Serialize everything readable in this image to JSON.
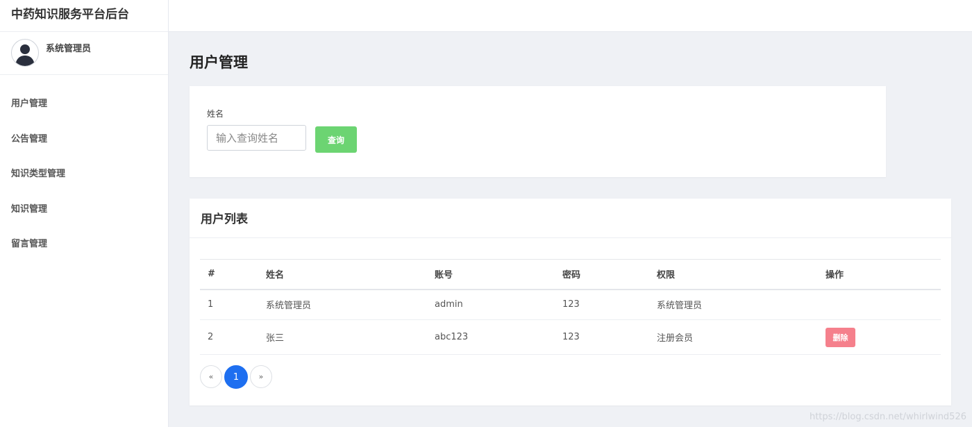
{
  "app": {
    "title": "中药知识服务平台后台"
  },
  "user": {
    "name": "系统管理员"
  },
  "sidebar": {
    "items": [
      {
        "label": "用户管理"
      },
      {
        "label": "公告管理"
      },
      {
        "label": "知识类型管理"
      },
      {
        "label": "知识管理"
      },
      {
        "label": "留言管理"
      }
    ]
  },
  "page": {
    "title": "用户管理"
  },
  "search": {
    "label": "姓名",
    "placeholder": "输入查询姓名",
    "button": "查询"
  },
  "list": {
    "title": "用户列表",
    "columns": [
      "#",
      "姓名",
      "账号",
      "密码",
      "权限",
      "操作"
    ],
    "rows": [
      {
        "index": "1",
        "name": "系统管理员",
        "account": "admin",
        "password": "123",
        "role": "系统管理员",
        "action": ""
      },
      {
        "index": "2",
        "name": "张三",
        "account": "abc123",
        "password": "123",
        "role": "注册会员",
        "action": "删除"
      }
    ]
  },
  "pagination": {
    "prev": "«",
    "current": "1",
    "next": "»"
  },
  "watermark": "https://blog.csdn.net/whirlwind526",
  "colors": {
    "accent": "#1e6ff0",
    "search_button": "#6cd472",
    "delete_button": "#f5808c",
    "background": "#eff1f5"
  }
}
